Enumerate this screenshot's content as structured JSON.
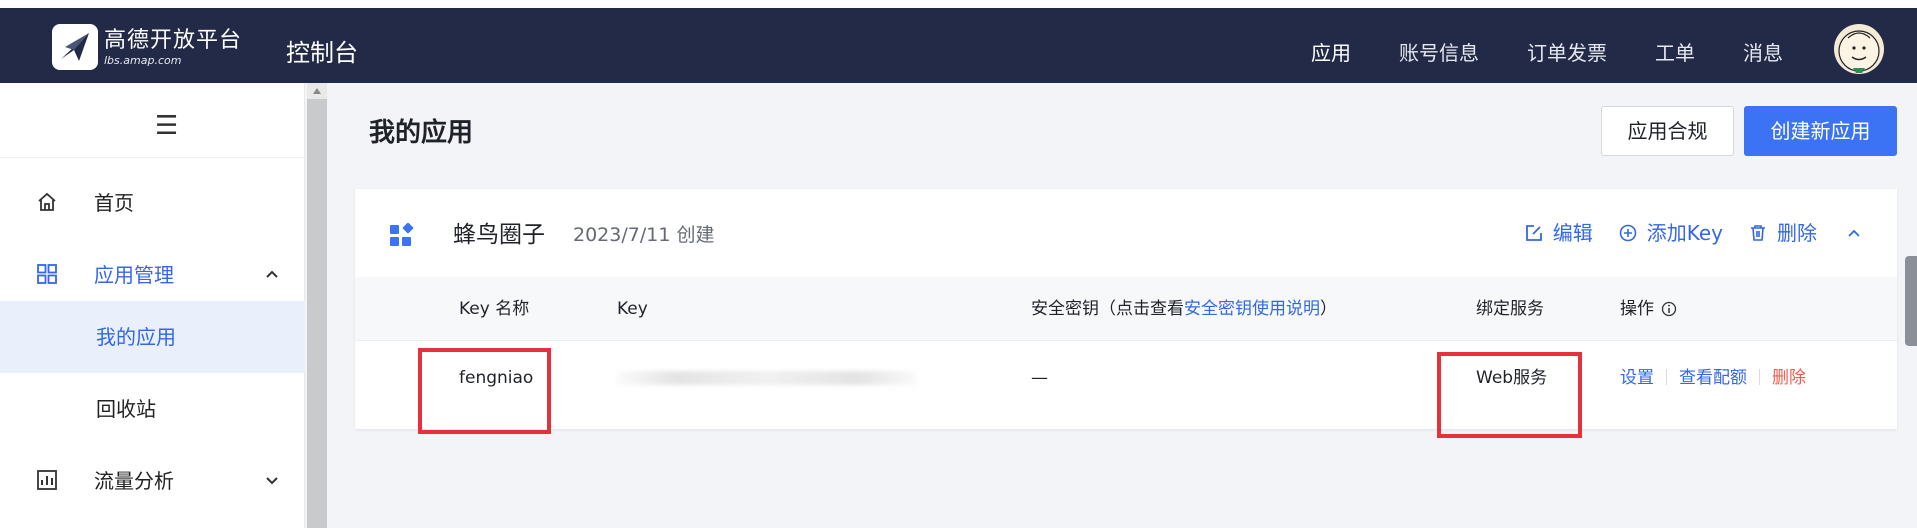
{
  "header": {
    "logo_cn": "高德开放平台",
    "logo_url": "lbs.amap.com",
    "console_title": "控制台",
    "nav": [
      "应用",
      "账号信息",
      "订单发票",
      "工单",
      "消息"
    ]
  },
  "sidebar": {
    "menu_icon": "☰",
    "items": [
      {
        "label": "首页",
        "icon": "home-icon"
      },
      {
        "label": "应用管理",
        "icon": "grid-icon"
      },
      {
        "label": "我的应用"
      },
      {
        "label": "回收站"
      },
      {
        "label": "流量分析",
        "icon": "chart-icon"
      }
    ]
  },
  "main": {
    "title": "我的应用",
    "compliance_button": "应用合规",
    "create_button": "创建新应用"
  },
  "app_card": {
    "name": "蜂鸟圈子",
    "created": "2023/7/11 创建",
    "actions": {
      "edit": "编辑",
      "add_key": "添加Key",
      "delete": "删除"
    },
    "columns": {
      "key_name": "Key 名称",
      "key": "Key",
      "secret_prefix": "安全密钥（点击查看",
      "secret_link": "安全密钥使用说明",
      "secret_suffix": "）",
      "service": "绑定服务",
      "operation": "操作"
    },
    "row": {
      "key_name": "fengniao",
      "secret": "—",
      "service": "Web服务",
      "op_settings": "设置",
      "op_quota": "查看配额",
      "op_delete": "删除"
    }
  },
  "colors": {
    "topbar": "#232a47",
    "primary": "#3b73f4",
    "danger": "#f05a4f",
    "highlight": "#e5313b"
  }
}
